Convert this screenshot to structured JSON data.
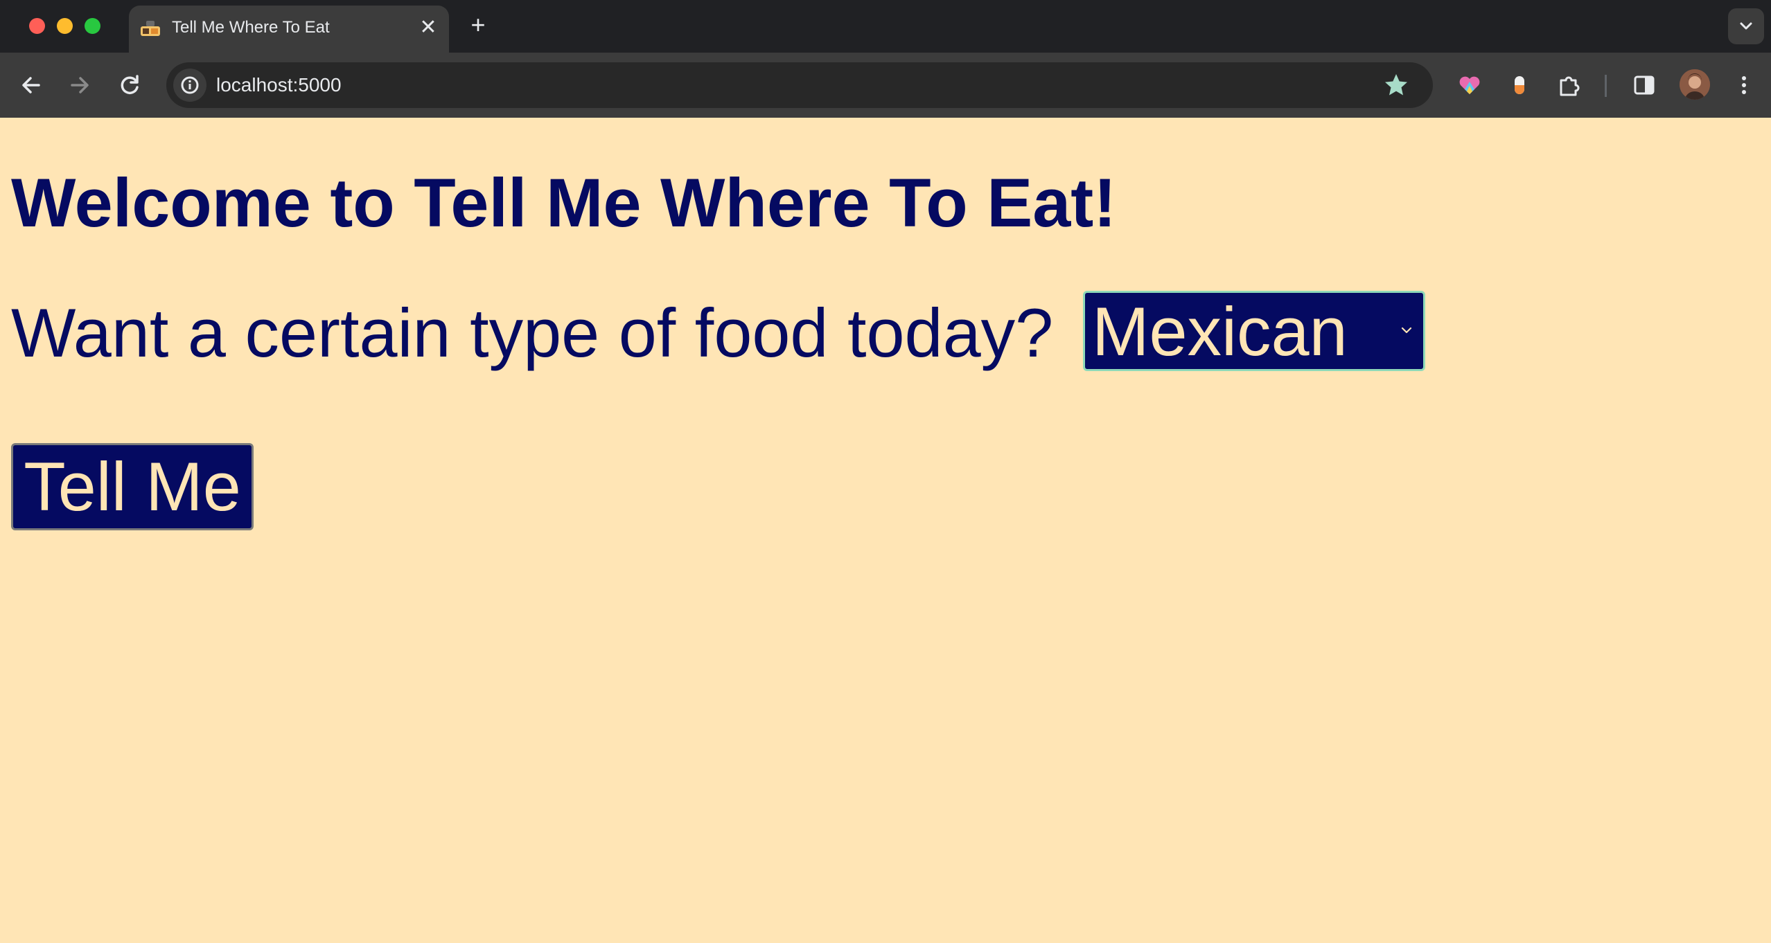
{
  "browser": {
    "tab": {
      "title": "Tell Me Where To Eat",
      "favicon": "food-favicon-icon",
      "close_glyph": "✕"
    },
    "new_tab_glyph": "+",
    "address_bar": {
      "url": "localhost:5000",
      "site_info_icon": "info-icon"
    },
    "toolbar_icons": [
      "back-arrow-icon",
      "forward-arrow-icon",
      "reload-icon",
      "bookmark-star-icon",
      "heart-extension-icon",
      "capsule-extension-icon",
      "extensions-puzzle-icon",
      "side-panel-icon",
      "profile-avatar",
      "more-menu-icon"
    ]
  },
  "page": {
    "background_color": "#ffe5b5",
    "text_color": "#050a61",
    "heading": "Welcome to Tell Me Where To Eat!",
    "prompt": "Want a certain type of food today?",
    "food_select": {
      "selected": "Mexican"
    },
    "submit_button": "Tell Me"
  }
}
